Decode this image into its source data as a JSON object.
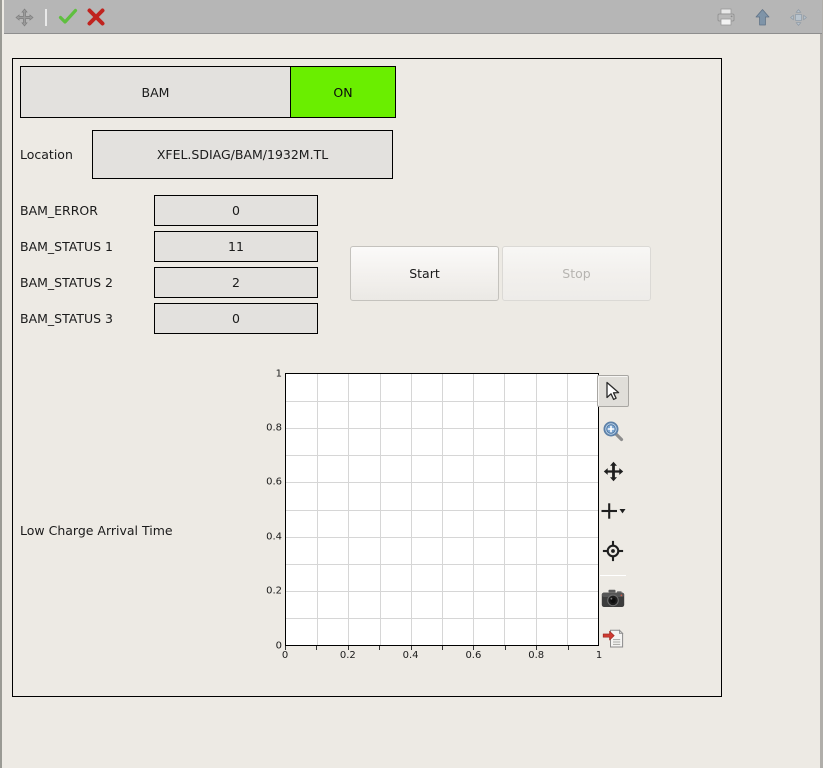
{
  "window": {
    "background_color": "#edeae4",
    "panel_border_color": "#000000"
  },
  "toolbar": {
    "background_color": "#b6b6b6",
    "left_items": [
      {
        "name": "move-icon",
        "label": "Move",
        "state": "disabled"
      },
      {
        "name": "separator",
        "label": "",
        "state": "static"
      },
      {
        "name": "check-icon",
        "label": "Apply",
        "state": "enabled"
      },
      {
        "name": "close-icon",
        "label": "Cancel",
        "state": "enabled"
      }
    ],
    "right_items": [
      {
        "name": "print-icon",
        "label": "Print",
        "state": "disabled"
      },
      {
        "name": "upload-icon",
        "label": "Upload",
        "state": "disabled"
      },
      {
        "name": "resize-icon",
        "label": "Resize",
        "state": "disabled"
      }
    ]
  },
  "device": {
    "name": "BAM",
    "state": "ON",
    "state_color": "#6aee00",
    "location_label": "Location",
    "location_value": "XFEL.SDIAG/BAM/1932M.TL"
  },
  "status_fields": [
    {
      "label": "BAM_ERROR",
      "value": "0"
    },
    {
      "label": "BAM_STATUS 1",
      "value": "11"
    },
    {
      "label": "BAM_STATUS 2",
      "value": "2"
    },
    {
      "label": "BAM_STATUS 3",
      "value": "0"
    }
  ],
  "actions": {
    "start_label": "Start",
    "start_enabled": true,
    "stop_label": "Stop",
    "stop_enabled": false
  },
  "plot": {
    "caption": "Low Charge Arrival Time",
    "tools": [
      {
        "name": "cursor-icon",
        "label": "Select",
        "selected": true
      },
      {
        "name": "zoom-in-icon",
        "label": "Zoom",
        "selected": false
      },
      {
        "name": "pan-icon",
        "label": "Pan",
        "selected": false
      },
      {
        "name": "crosshair-dropdown-icon",
        "label": "Crosshair",
        "selected": false
      },
      {
        "name": "target-icon",
        "label": "Marker",
        "selected": false
      },
      {
        "name": "camera-icon",
        "label": "Screenshot",
        "selected": false
      },
      {
        "name": "export-icon",
        "label": "Export",
        "selected": false
      }
    ]
  },
  "chart_data": {
    "type": "line",
    "title": "Low Charge Arrival Time",
    "xlabel": "",
    "ylabel": "",
    "xlim": [
      0,
      1
    ],
    "ylim": [
      0,
      1
    ],
    "xticks": [
      "0",
      "0.2",
      "0.4",
      "0.6",
      "0.8",
      "1"
    ],
    "yticks": [
      "0",
      "0.2",
      "0.4",
      "0.6",
      "0.8",
      "1"
    ],
    "xtick_values": [
      0,
      0.2,
      0.4,
      0.6,
      0.8,
      1
    ],
    "ytick_values": [
      0,
      0.2,
      0.4,
      0.6,
      0.8,
      1
    ],
    "grid": true,
    "legend": "none",
    "series": [],
    "values": [],
    "note": "empty plot - no data acquired"
  }
}
